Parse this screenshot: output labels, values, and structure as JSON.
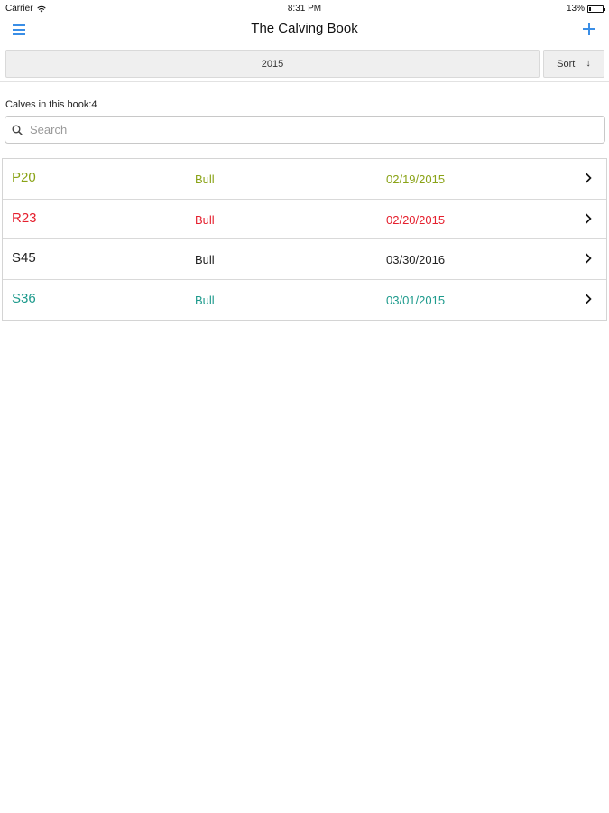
{
  "status_bar": {
    "carrier": "Carrier",
    "time": "8:31 PM",
    "battery": "13%",
    "battery_level": 0.13
  },
  "nav": {
    "title": "The Calving Book",
    "menu_icon": "hamburger-menu-icon",
    "add_icon": "plus-icon",
    "accent_color": "#3a8ee6"
  },
  "filter": {
    "year": "2015",
    "sort_label": "Sort",
    "sort_arrow": "↓"
  },
  "count_label": "Calves in this book:4",
  "search": {
    "placeholder": "Search",
    "value": ""
  },
  "calves": [
    {
      "tag": "P20",
      "sex": "Bull",
      "date": "02/19/2015",
      "color": "#8aa317"
    },
    {
      "tag": "R23",
      "sex": "Bull",
      "date": "02/20/2015",
      "color": "#e5202e"
    },
    {
      "tag": "S45",
      "sex": "Bull",
      "date": "03/30/2016",
      "color": "#222222"
    },
    {
      "tag": "S36",
      "sex": "Bull",
      "date": "03/01/2015",
      "color": "#1d9a8c"
    }
  ]
}
